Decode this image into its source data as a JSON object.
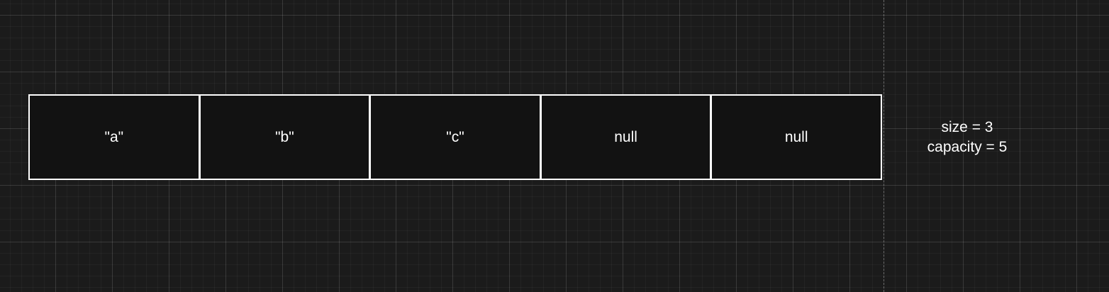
{
  "array": {
    "cells": [
      {
        "value": "\"a\""
      },
      {
        "value": "\"b\""
      },
      {
        "value": "\"c\""
      },
      {
        "value": "null"
      },
      {
        "value": "null"
      }
    ]
  },
  "info": {
    "size_text": "size = 3",
    "capacity_text": "capacity = 5"
  },
  "colors": {
    "background": "#1b1b1b",
    "cell_fill": "#121212",
    "stroke": "#ffffff",
    "text": "#ffffff"
  }
}
